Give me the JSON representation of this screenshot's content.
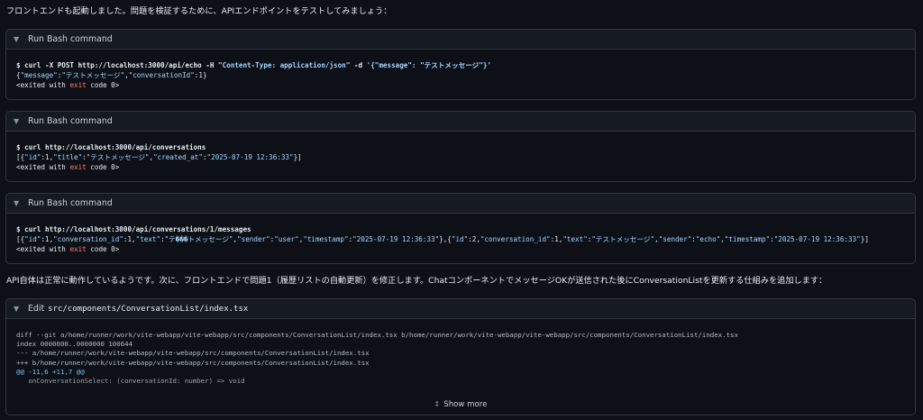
{
  "intro_text": "フロントエンドも起動しました。問題を検証するために、APIエンドポイントをテストしてみましょう：",
  "bash_blocks": [
    {
      "header": "Run Bash command",
      "command": "$ curl -X POST http://localhost:3000/api/echo -H ",
      "command_str": "\"Content-Type: application/json\"",
      "command_mid": " -d ",
      "command_str2": "'{\"message\": \"テストメッセージ\"}'",
      "output_parts": [
        {
          "t": "{",
          "c": "plain"
        },
        {
          "t": "\"message\"",
          "c": "str"
        },
        {
          "t": ":",
          "c": "plain"
        },
        {
          "t": "\"テストメッセージ\"",
          "c": "str"
        },
        {
          "t": ",",
          "c": "plain"
        },
        {
          "t": "\"conversationId\"",
          "c": "str"
        },
        {
          "t": ":1}",
          "c": "plain"
        }
      ],
      "exit_pre": "<exited with ",
      "exit_kw": "exit",
      "exit_post": " code 0>"
    },
    {
      "header": "Run Bash command",
      "command": "$ curl http://localhost:3000/api/conversations",
      "output_parts": [
        {
          "t": "[{",
          "c": "plain"
        },
        {
          "t": "\"id\"",
          "c": "str"
        },
        {
          "t": ":1,",
          "c": "plain"
        },
        {
          "t": "\"title\"",
          "c": "str"
        },
        {
          "t": ":",
          "c": "plain"
        },
        {
          "t": "\"テストメッセージ\"",
          "c": "str"
        },
        {
          "t": ",",
          "c": "plain"
        },
        {
          "t": "\"created_at\"",
          "c": "str"
        },
        {
          "t": ":",
          "c": "plain"
        },
        {
          "t": "\"2025-07-19 12:36:33\"",
          "c": "str"
        },
        {
          "t": "}]",
          "c": "plain"
        }
      ],
      "exit_pre": "<exited with ",
      "exit_kw": "exit",
      "exit_post": " code 0>"
    },
    {
      "header": "Run Bash command",
      "command": "$ curl http://localhost:3000/api/conversations/1/messages",
      "output_parts": [
        {
          "t": "[{",
          "c": "plain"
        },
        {
          "t": "\"id\"",
          "c": "str"
        },
        {
          "t": ":1,",
          "c": "plain"
        },
        {
          "t": "\"conversation_id\"",
          "c": "str"
        },
        {
          "t": ":1,",
          "c": "plain"
        },
        {
          "t": "\"text\"",
          "c": "str"
        },
        {
          "t": ":",
          "c": "plain"
        },
        {
          "t": "\"テ���トメッセージ\"",
          "c": "str"
        },
        {
          "t": ",",
          "c": "plain"
        },
        {
          "t": "\"sender\"",
          "c": "str"
        },
        {
          "t": ":",
          "c": "plain"
        },
        {
          "t": "\"user\"",
          "c": "str"
        },
        {
          "t": ",",
          "c": "plain"
        },
        {
          "t": "\"timestamp\"",
          "c": "str"
        },
        {
          "t": ":",
          "c": "plain"
        },
        {
          "t": "\"2025-07-19 12:36:33\"",
          "c": "str"
        },
        {
          "t": "},{",
          "c": "plain"
        },
        {
          "t": "\"id\"",
          "c": "str"
        },
        {
          "t": ":2,",
          "c": "plain"
        },
        {
          "t": "\"conversation_id\"",
          "c": "str"
        },
        {
          "t": ":1,",
          "c": "plain"
        },
        {
          "t": "\"text\"",
          "c": "str"
        },
        {
          "t": ":",
          "c": "plain"
        },
        {
          "t": "\"テストメッセージ\"",
          "c": "str"
        },
        {
          "t": ",",
          "c": "plain"
        },
        {
          "t": "\"sender\"",
          "c": "str"
        },
        {
          "t": ":",
          "c": "plain"
        },
        {
          "t": "\"echo\"",
          "c": "str"
        },
        {
          "t": ",",
          "c": "plain"
        },
        {
          "t": "\"timestamp\"",
          "c": "str"
        },
        {
          "t": ":",
          "c": "plain"
        },
        {
          "t": "\"2025-07-19 12:36:33\"",
          "c": "str"
        },
        {
          "t": "}]",
          "c": "plain"
        }
      ],
      "exit_pre": "<exited with ",
      "exit_kw": "exit",
      "exit_post": " code 0>"
    }
  ],
  "middle_text": "API自体は正常に動作しているようです。次に、フロントエンドで問題1（履歴リストの自動更新）を修正します。ChatコンポーネントでメッセージOKが送信された後にConversationListを更新する仕組みを追加します：",
  "edit_block": {
    "header_label": "Edit",
    "header_path": "src/components/ConversationList/index.tsx",
    "diff_lines": [
      {
        "t": "diff --git a/home/runner/work/vite-webapp/vite-webapp/src/components/ConversationList/index.tsx b/home/runner/work/vite-webapp/vite-webapp/src/components/ConversationList/index.tsx",
        "c": ""
      },
      {
        "t": "index 0000000..0000000 100644",
        "c": ""
      },
      {
        "t": "--- a/home/runner/work/vite-webapp/vite-webapp/src/components/ConversationList/index.tsx",
        "c": ""
      },
      {
        "t": "+++ b/home/runner/work/vite-webapp/vite-webapp/src/components/ConversationList/index.tsx",
        "c": ""
      },
      {
        "t": "@@ -11,6 +11,7 @@",
        "c": "diff-hunk"
      },
      {
        "t": "   onConversationSelect: (conversationId: number) => void",
        "c": ""
      }
    ],
    "show_more_label": "Show more"
  },
  "icons": {
    "chevron": "chevron-down-icon",
    "expand": "expand-vertical-icon"
  },
  "colors": {
    "background": "#0d1117",
    "card_header": "#161b22",
    "border": "#30363d",
    "string": "#a5d6ff",
    "keyword": "#ff7b72",
    "hunk": "#79c0ff"
  }
}
